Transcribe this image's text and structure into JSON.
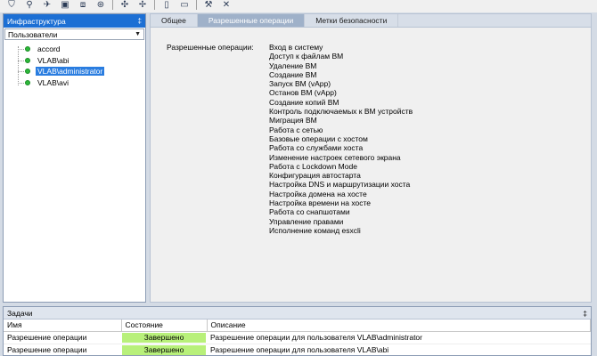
{
  "toolbar": {
    "icons": [
      "shield-icon",
      "search-icon",
      "pin-icon",
      "box-icon",
      "package-icon",
      "target-icon",
      "network-icon",
      "network-icon",
      "document-icon",
      "screen-icon",
      "tool-icon",
      "tools-icon"
    ]
  },
  "infrastructure": {
    "title": "Инфраструктура",
    "pin": "‡",
    "dropdown_value": "Пользователи",
    "items": [
      {
        "label": "accord",
        "selected": false
      },
      {
        "label": "VLAB\\abi",
        "selected": false
      },
      {
        "label": "VLAB\\administrator",
        "selected": true
      },
      {
        "label": "VLAB\\avi",
        "selected": false
      }
    ]
  },
  "details": {
    "tabs": [
      {
        "label": "Общее",
        "active": false
      },
      {
        "label": "Разрешенные операции",
        "active": true
      },
      {
        "label": "Метки безопасности",
        "active": false
      }
    ],
    "permissions_label": "Разрешенные операции:",
    "permissions": [
      "Вход в систему",
      "Доступ к файлам ВМ",
      "Удаление ВМ",
      "Создание ВМ",
      "Запуск ВМ (vApp)",
      "Останов ВМ (vApp)",
      "Создание копий ВМ",
      "Контроль подключаемых к ВМ устройств",
      "Миграция ВМ",
      "Работа с сетью",
      "Базовые операции с хостом",
      "Работа со службами хоста",
      "Изменение настроек сетевого экрана",
      "Работа с Lockdown Mode",
      "Конфигурация автостарта",
      "Настройка DNS и маршрутизации хоста",
      "Настройка домена на хосте",
      "Настройка времени на хосте",
      "Работа со снапшотами",
      "Управление правами",
      "Исполнение команд esxcli"
    ]
  },
  "tasks": {
    "title": "Задачи",
    "pin": "‡",
    "columns": [
      "Имя",
      "Состояние",
      "Описание"
    ],
    "rows": [
      {
        "name": "Разрешение операции",
        "status": "Завершено",
        "description": "Разрешение операции для пользователя VLAB\\administrator"
      },
      {
        "name": "Разрешение операции",
        "status": "Завершено",
        "description": "Разрешение операции для пользователя VLAB\\abi"
      }
    ]
  }
}
